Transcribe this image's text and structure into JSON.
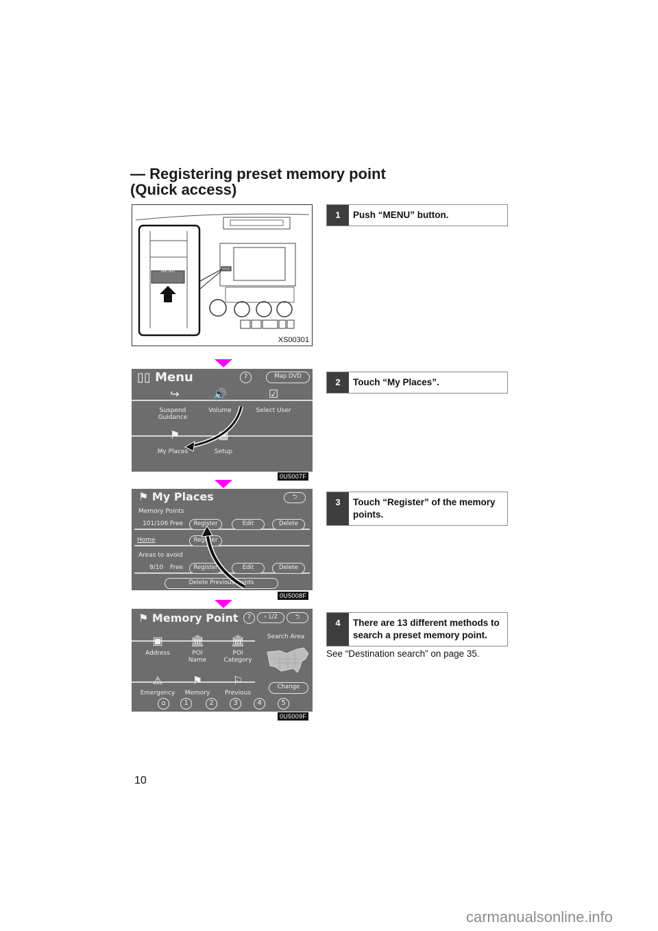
{
  "section_title_line1": "— Registering preset memory point",
  "section_title_line2": "(Quick access)",
  "steps": [
    {
      "num": "1",
      "text": "Push “MENU” button."
    },
    {
      "num": "2",
      "text": "Touch “My Places”."
    },
    {
      "num": "3",
      "text": "Touch “Register” of the memory points."
    },
    {
      "num": "4",
      "text": "There are 13 different methods to search a preset memory point."
    }
  ],
  "note": "See “Destination search” on page 35.",
  "figures": {
    "dashboard": {
      "code": "XS00301",
      "button_label": "MENU"
    },
    "menu": {
      "code": "0U5007F",
      "title": "Menu",
      "help": "?",
      "map_dvd": "Map DVD",
      "items": [
        "Suspend Guidance",
        "Volume",
        "Select User",
        "My Places",
        "Setup"
      ]
    },
    "my_places": {
      "code": "0U5008F",
      "title": "My Places",
      "memory_points_label": "Memory Points",
      "memory_points_count": "101/106",
      "free_label": "Free",
      "home_label": "Home",
      "areas_label": "Areas to avoid",
      "areas_count": "9/10",
      "register": "Register",
      "edit": "Edit",
      "delete": "Delete",
      "delete_previous": "Delete Previous Points"
    },
    "memory_point": {
      "code": "0U5009F",
      "title": "Memory Point",
      "help": "?",
      "page": "1/2",
      "items": [
        "Address",
        "POI Name",
        "POI Category",
        "Emergency",
        "Memory",
        "Previous"
      ],
      "search_area": "Search Area",
      "change": "Change",
      "numbers": [
        "1",
        "2",
        "3",
        "4",
        "5"
      ]
    }
  },
  "page_number": "10",
  "watermark": "carmanualsonline.info"
}
